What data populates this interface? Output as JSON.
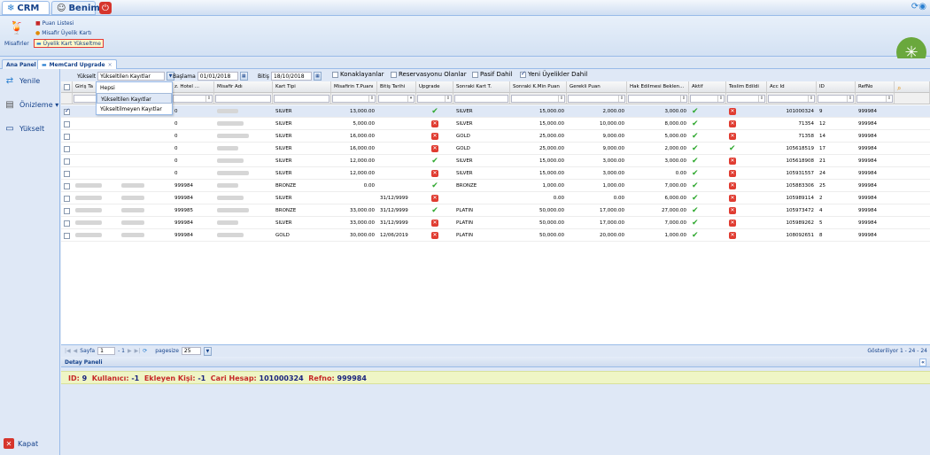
{
  "topbar": {
    "crm_label": "CRM",
    "benim_label": "Benim",
    "sync_icon": "sync-icon"
  },
  "ribbon": {
    "group_label": "Misafirler",
    "items": [
      {
        "label": "Puan Listesi"
      },
      {
        "label": "Misafir Üyelik Kartı"
      },
      {
        "label": "Üyelik Kart Yükseltme"
      }
    ]
  },
  "tabs": [
    {
      "label": "Ana Panel"
    },
    {
      "label": "MemCard Upgrade"
    }
  ],
  "sidebar": {
    "items": [
      {
        "label": "Yenile",
        "icon": "refresh-icon"
      },
      {
        "label": "Önizleme ▾",
        "icon": "printer-icon"
      },
      {
        "label": "Yükselt",
        "icon": "card-icon"
      }
    ],
    "close_label": "Kapat"
  },
  "filters": {
    "mode_label": "Yükselt",
    "mode_value": "Yükseltilen Kayıtlar",
    "start_label": "Başlama",
    "start_value": "01/01/2018",
    "end_label": "Bitiş",
    "end_value": "18/10/2018",
    "checks": [
      {
        "label": "Konaklayanlar",
        "checked": false
      },
      {
        "label": "Reservasyonu Olanlar",
        "checked": false
      },
      {
        "label": "Pasif Dahil",
        "checked": false
      },
      {
        "label": "Yeni Üyelikler Dahil",
        "checked": true
      }
    ]
  },
  "dropdown": {
    "options": [
      "Hepsi",
      "Yükseltilen Kayıtlar",
      "Yükseltilmeyen Kayıtlar"
    ],
    "highlighted": 1
  },
  "grid": {
    "columns": [
      "Giriş Ta",
      "z. Hotel ...",
      "Misafir Adı",
      "Kart Tipi",
      "Misafirin T.Puanı",
      "Bitiş Tarihi",
      "Upgrade",
      "Sonraki Kart T.",
      "Sonraki K.Min Puan",
      "Gerekli Puan",
      "Hak Edilmesi Beklen...",
      "Aktif",
      "Teslim Edildi",
      "Acc Id",
      "ID",
      "RefNo"
    ],
    "rows": [
      {
        "selected": true,
        "hotel": "0",
        "kart": "SILVER",
        "puan": "13,000.00",
        "bitis": "",
        "upgrade": true,
        "sonraki": "SILVER",
        "minpuan": "15,000.00",
        "gerekli": "2,000.00",
        "hak": "3,000.00",
        "aktif": true,
        "teslim": false,
        "acc": "101000324",
        "id": "9",
        "ref": "999984"
      },
      {
        "selected": false,
        "hotel": "0",
        "kart": "SILVER",
        "puan": "5,000.00",
        "bitis": "",
        "upgrade": false,
        "sonraki": "SILVER",
        "minpuan": "15,000.00",
        "gerekli": "10,000.00",
        "hak": "8,000.00",
        "aktif": true,
        "teslim": false,
        "acc": "71354",
        "id": "12",
        "ref": "999984"
      },
      {
        "selected": false,
        "hotel": "0",
        "kart": "SILVER",
        "puan": "16,000.00",
        "bitis": "",
        "upgrade": false,
        "sonraki": "GOLD",
        "minpuan": "25,000.00",
        "gerekli": "9,000.00",
        "hak": "5,000.00",
        "aktif": true,
        "teslim": false,
        "acc": "71358",
        "id": "14",
        "ref": "999984"
      },
      {
        "selected": false,
        "hotel": "0",
        "kart": "SILVER",
        "puan": "16,000.00",
        "bitis": "",
        "upgrade": false,
        "sonraki": "GOLD",
        "minpuan": "25,000.00",
        "gerekli": "9,000.00",
        "hak": "2,000.00",
        "aktif": true,
        "teslim": true,
        "acc": "105618519",
        "id": "17",
        "ref": "999984"
      },
      {
        "selected": false,
        "hotel": "0",
        "kart": "SILVER",
        "puan": "12,000.00",
        "bitis": "",
        "upgrade": true,
        "sonraki": "SILVER",
        "minpuan": "15,000.00",
        "gerekli": "3,000.00",
        "hak": "3,000.00",
        "aktif": true,
        "teslim": false,
        "acc": "105618908",
        "id": "21",
        "ref": "999984"
      },
      {
        "selected": false,
        "hotel": "0",
        "kart": "SILVER",
        "puan": "12,000.00",
        "bitis": "",
        "upgrade": false,
        "sonraki": "SILVER",
        "minpuan": "15,000.00",
        "gerekli": "3,000.00",
        "hak": "0.00",
        "aktif": true,
        "teslim": false,
        "acc": "105931557",
        "id": "24",
        "ref": "999984"
      },
      {
        "selected": false,
        "hotel": "999984",
        "kart": "BRONZE",
        "puan": "0.00",
        "bitis": "",
        "upgrade": true,
        "sonraki": "BRONZE",
        "minpuan": "1,000.00",
        "gerekli": "1,000.00",
        "hak": "7,000.00",
        "aktif": true,
        "teslim": false,
        "acc": "105883306",
        "id": "25",
        "ref": "999984"
      },
      {
        "selected": false,
        "hotel": "999984",
        "kart": "SILVER",
        "puan": "",
        "bitis": "31/12/9999",
        "upgrade": false,
        "sonraki": "",
        "minpuan": "0.00",
        "gerekli": "0.00",
        "hak": "6,000.00",
        "aktif": true,
        "teslim": false,
        "acc": "105989114",
        "id": "2",
        "ref": "999984"
      },
      {
        "selected": false,
        "hotel": "999985",
        "kart": "BRONZE",
        "puan": "33,000.00",
        "bitis": "31/12/9999",
        "upgrade": true,
        "sonraki": "PLATIN",
        "minpuan": "50,000.00",
        "gerekli": "17,000.00",
        "hak": "27,000.00",
        "aktif": true,
        "teslim": false,
        "acc": "105973472",
        "id": "4",
        "ref": "999984"
      },
      {
        "selected": false,
        "hotel": "999984",
        "kart": "SILVER",
        "puan": "33,000.00",
        "bitis": "31/12/9999",
        "upgrade": false,
        "sonraki": "PLATIN",
        "minpuan": "50,000.00",
        "gerekli": "17,000.00",
        "hak": "7,000.00",
        "aktif": true,
        "teslim": false,
        "acc": "105989262",
        "id": "5",
        "ref": "999984"
      },
      {
        "selected": false,
        "hotel": "999984",
        "kart": "GOLD",
        "puan": "30,000.00",
        "bitis": "12/06/2019",
        "upgrade": false,
        "sonraki": "PLATIN",
        "minpuan": "50,000.00",
        "gerekli": "20,000.00",
        "hak": "1,000.00",
        "aktif": true,
        "teslim": false,
        "acc": "108092651",
        "id": "8",
        "ref": "999984"
      }
    ]
  },
  "pager": {
    "page_label": "Sayfa",
    "page_value": "1",
    "of_label": "- 1",
    "pagesize_label": "pagesize",
    "pagesize_value": "25",
    "info": "Gösteriliyor 1 - 24 - 24"
  },
  "detail": {
    "title": "Detay Paneli",
    "id_label": "ID:",
    "id_value": "9",
    "user_label": "Kullanıcı:",
    "user_value": "-1",
    "adder_label": "Ekleyen Kişi:",
    "adder_value": "-1",
    "account_label": "Cari Hesap:",
    "account_value": "101000324",
    "ref_label": "Refno:",
    "ref_value": "999984"
  },
  "colors": {
    "accent": "#15428b",
    "panel": "#dfe8f6",
    "ok": "#2fa82f",
    "no": "#e03c31",
    "highlight": "#eff5c5"
  }
}
